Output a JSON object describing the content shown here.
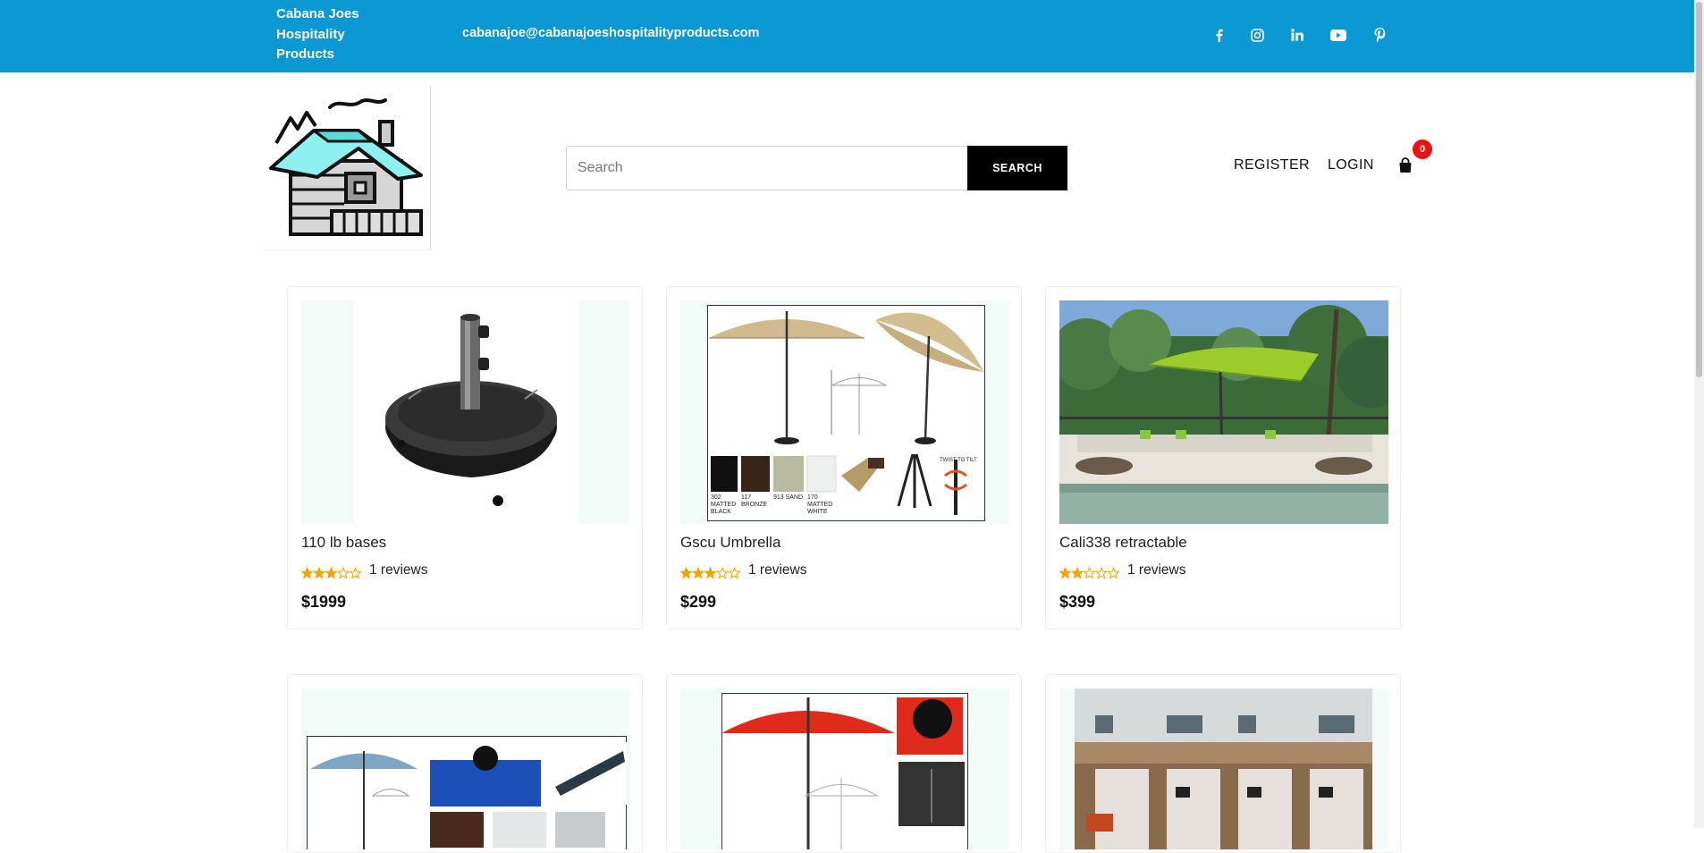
{
  "topbar": {
    "brand": "Cabana Joes Hospitality Products",
    "email": "cabanajoe@cabanajoeshospitalityproducts.com",
    "socials": [
      "facebook-icon",
      "instagram-icon",
      "linkedin-icon",
      "youtube-icon",
      "pinterest-icon"
    ],
    "background_color": "#0b98d3"
  },
  "header": {
    "search_placeholder": "Search",
    "search_button": "SEARCH",
    "register": "REGISTER",
    "login": "LOGIN",
    "cart_count": "0"
  },
  "products": [
    {
      "title": "110 lb bases",
      "rating": 3,
      "reviews": "1 reviews",
      "price": "$1999"
    },
    {
      "title": "Gscu Umbrella",
      "rating": 3,
      "reviews": "1 reviews",
      "price": "$299"
    },
    {
      "title": "Cali338 retractable",
      "rating": 2,
      "reviews": "1 reviews",
      "price": "$399"
    }
  ],
  "gscu_swatches": [
    "302 MATTED BLACK",
    "117 BRONZE",
    "913 SAND",
    "170 MATTED WHITE"
  ],
  "gscu_tilt": "TWIST TO TILT",
  "colors": {
    "star": "#f0a500",
    "badge": "#ee1111"
  }
}
